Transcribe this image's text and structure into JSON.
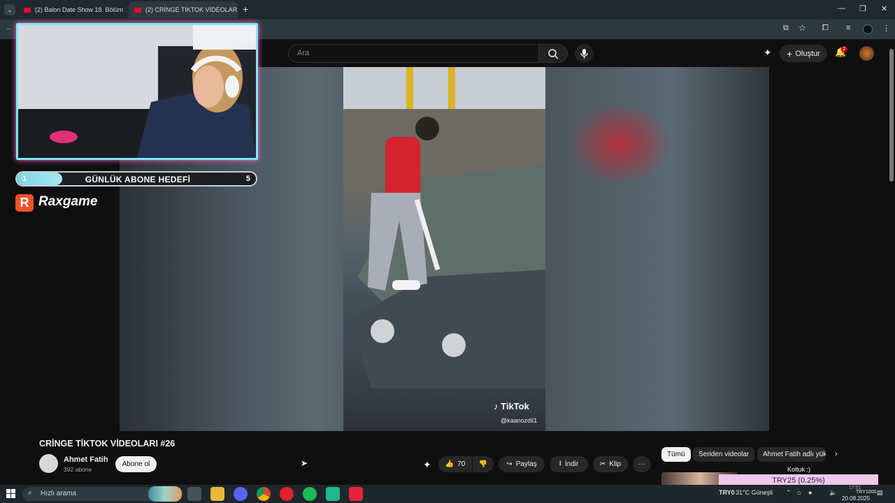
{
  "browser": {
    "tabs": [
      {
        "label": "(2) Balon Date Show 18. Bölüm"
      },
      {
        "label": "(2) CRİNGE TİKTOK VİDEOLAR"
      }
    ],
    "tab_close": "✕",
    "new_tab": "+"
  },
  "youtube": {
    "search_placeholder": "Ara",
    "create_label": "Oluştur",
    "notification_count": "2"
  },
  "overlay": {
    "goal_start": "1",
    "goal_label": "GÜNLÜK ABONE HEDEFİ",
    "goal_end": "5",
    "goal_progress": 0.19,
    "brand_letter": "R",
    "brand_name": "Raxgame"
  },
  "video": {
    "watermark": "TikTok",
    "watermark_user": "@kaanozdil1",
    "title": "CRİNGE TİKTOK VİDEOLARI #26",
    "channel": "Ahmet Fatih",
    "subscribers": "392 abone",
    "subscribe_label": "Abone ol",
    "likes": "70",
    "share_label": "Paylaş",
    "download_label": "İndir",
    "clip_label": "Klip",
    "more_label": "···"
  },
  "chips": [
    {
      "label": "Tümü",
      "active": true
    },
    {
      "label": "Seriden videolar",
      "active": false
    },
    {
      "label": "Ahmet Fatih adlı yük",
      "active": false
    }
  ],
  "ticker": {
    "top": "Koltuk :)",
    "text": "TRY25 (0.25%)"
  },
  "taskbar": {
    "search_placeholder": "Hızlı arama",
    "currency": "TRY0",
    "weather": "31°C  Güneşli",
    "time": "17:51",
    "date": "20.08.2025",
    "tray_small": "TRY1000"
  },
  "colors": {
    "youtube_red": "#ff0033",
    "overlay_cyan": "#7fe7f5",
    "overlay_pink": "#ff66cc",
    "brand_orange": "#f0522a",
    "ticker_pink": "#efc8ec"
  }
}
